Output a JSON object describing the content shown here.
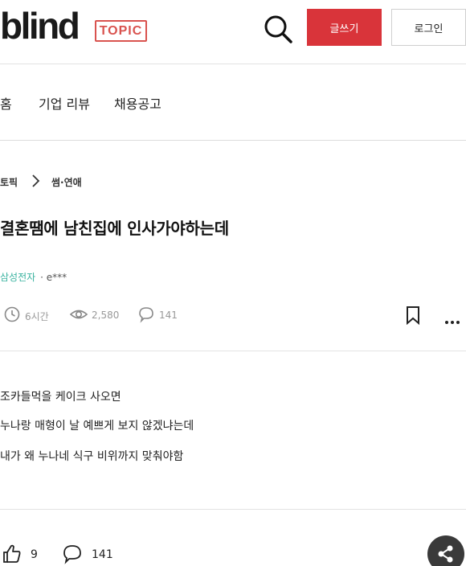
{
  "header": {
    "logo": "blind",
    "badge": "TOPIC",
    "write_label": "글쓰기",
    "login_label": "로그인",
    "accent_color": "#d9343a"
  },
  "nav": {
    "items": [
      {
        "label": "홈"
      },
      {
        "label": "기업 리뷰"
      },
      {
        "label": "채용공고"
      }
    ]
  },
  "breadcrumb": {
    "root": "토픽",
    "current": "썸·연애"
  },
  "post": {
    "title": "결혼땜에 남친집에 인사가야하는데",
    "company": "삼성전자",
    "author": "· e***",
    "time": "6시간",
    "views": "2,580",
    "comments": "141",
    "lines": [
      "조카들먹을 케이크 사오면",
      "누나랑 매형이 날 예쁘게 보지 않겠냐는데",
      "내가 왜 누나네 식구 비위까지 맞춰야함"
    ]
  },
  "footer": {
    "likes": "9",
    "comments": "141"
  }
}
